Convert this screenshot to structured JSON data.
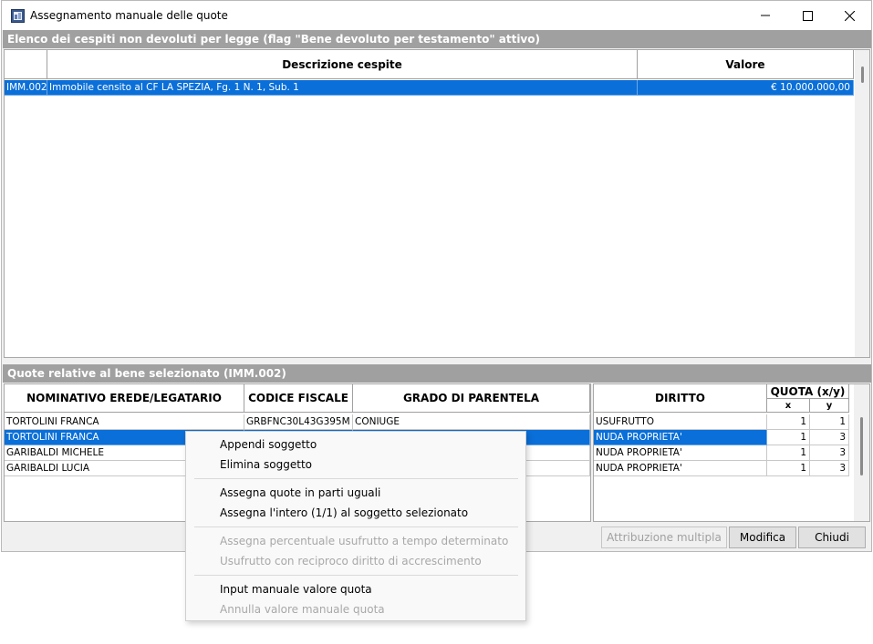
{
  "window": {
    "title": "Assegnamento manuale delle quote",
    "icon": "app-window-icon",
    "controls": [
      "minimize-icon",
      "maximize-icon",
      "close-icon"
    ]
  },
  "section_top": {
    "label": "Elenco dei cespiti non devoluti per legge (flag \"Bene devoluto per testamento\" attivo)"
  },
  "assets_table": {
    "headers": [
      "",
      "Descrizione cespite",
      "Valore"
    ],
    "rows": [
      {
        "code": "IMM.002",
        "description": "Immobile censito al CF LA SPEZIA, Fg. 1 N. 1, Sub. 1",
        "value": "€ 10.000.000,00",
        "selected": true
      }
    ]
  },
  "section_bottom": {
    "label": "Quote relative al bene selezionato (IMM.002)"
  },
  "heirs_table": {
    "headers": [
      "NOMINATIVO EREDE/LEGATARIO",
      "CODICE FISCALE",
      "GRADO DI PARENTELA"
    ],
    "rows": [
      {
        "name": "TORTOLINI FRANCA",
        "cf": "GRBFNC30L43G395M",
        "grade": "CONIUGE",
        "selected": false
      },
      {
        "name": "TORTOLINI FRANCA",
        "cf": "",
        "grade": "",
        "selected": true
      },
      {
        "name": "GARIBALDI MICHELE",
        "cf": "",
        "grade": "",
        "selected": false
      },
      {
        "name": "GARIBALDI LUCIA",
        "cf": "",
        "grade": "",
        "selected": false
      }
    ]
  },
  "rights_table": {
    "header_right": "DIRITTO",
    "header_quota": "QUOTA (x/y)",
    "header_x": "x",
    "header_y": "y",
    "rows": [
      {
        "right": "USUFRUTTO",
        "x": "1",
        "y": "1",
        "selected": false
      },
      {
        "right": "NUDA PROPRIETA'",
        "x": "1",
        "y": "3",
        "selected": true
      },
      {
        "right": "NUDA PROPRIETA'",
        "x": "1",
        "y": "3",
        "selected": false
      },
      {
        "right": "NUDA PROPRIETA'",
        "x": "1",
        "y": "3",
        "selected": false
      }
    ]
  },
  "buttons": {
    "multi": "Attribuzione multipla",
    "edit": "Modifica",
    "close": "Chiudi"
  },
  "context_menu": {
    "items": [
      {
        "label": "Appendi soggetto",
        "enabled": true
      },
      {
        "label": "Elimina soggetto",
        "enabled": true
      },
      {
        "label": "Assegna quote in parti uguali",
        "enabled": true
      },
      {
        "label": "Assegna l'intero (1/1) al soggetto selezionato",
        "enabled": true
      },
      {
        "label": "Assegna percentuale usufrutto a tempo determinato",
        "enabled": false
      },
      {
        "label": "Usufrutto con reciproco diritto di accrescimento",
        "enabled": false
      },
      {
        "label": "Input manuale valore quota",
        "enabled": true
      },
      {
        "label": "Annulla valore manuale quota",
        "enabled": false
      }
    ]
  },
  "colors": {
    "selection": "#0a6fd8",
    "section_header": "#a0a0a0"
  }
}
